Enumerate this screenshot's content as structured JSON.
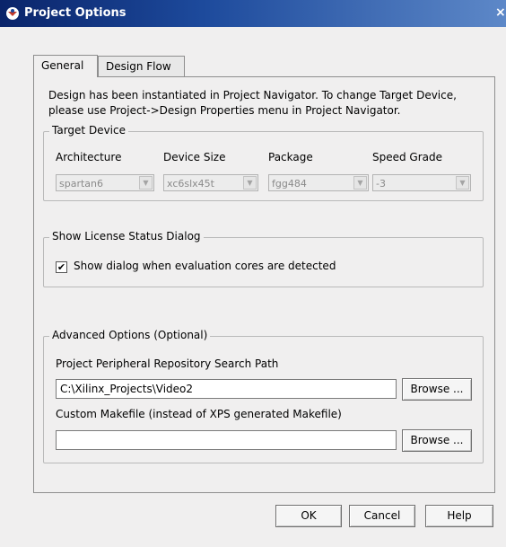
{
  "window": {
    "title": "Project Options",
    "close_glyph": "×"
  },
  "tabs": [
    {
      "label": "General",
      "active": true
    },
    {
      "label": "Design Flow",
      "active": false
    }
  ],
  "general": {
    "description": "Design has been instantiated in Project Navigator. To change Target Device, please use Project->Design Properties menu in Project Navigator.",
    "target_device": {
      "legend": "Target Device",
      "architecture": {
        "label": "Architecture",
        "value": "spartan6"
      },
      "device_size": {
        "label": "Device Size",
        "value": "xc6slx45t"
      },
      "package": {
        "label": "Package",
        "value": "fgg484"
      },
      "speed_grade": {
        "label": "Speed Grade",
        "value": "-3"
      }
    },
    "license": {
      "legend": "Show License Status Dialog",
      "checkbox_label": "Show dialog when evaluation cores are detected",
      "checked": true
    },
    "advanced": {
      "legend": "Advanced Options (Optional)",
      "repo_path_label": "Project Peripheral Repository Search Path",
      "repo_path_value": "C:\\Xilinx_Projects\\Video2",
      "repo_browse": "Browse ...",
      "makefile_label": "Custom Makefile (instead of XPS generated Makefile)",
      "makefile_value": "",
      "makefile_browse": "Browse ..."
    }
  },
  "buttons": {
    "ok": "OK",
    "cancel": "Cancel",
    "help": "Help"
  },
  "colors": {
    "title_bar": "#0a246a",
    "dialog_bg": "#f0efef"
  }
}
